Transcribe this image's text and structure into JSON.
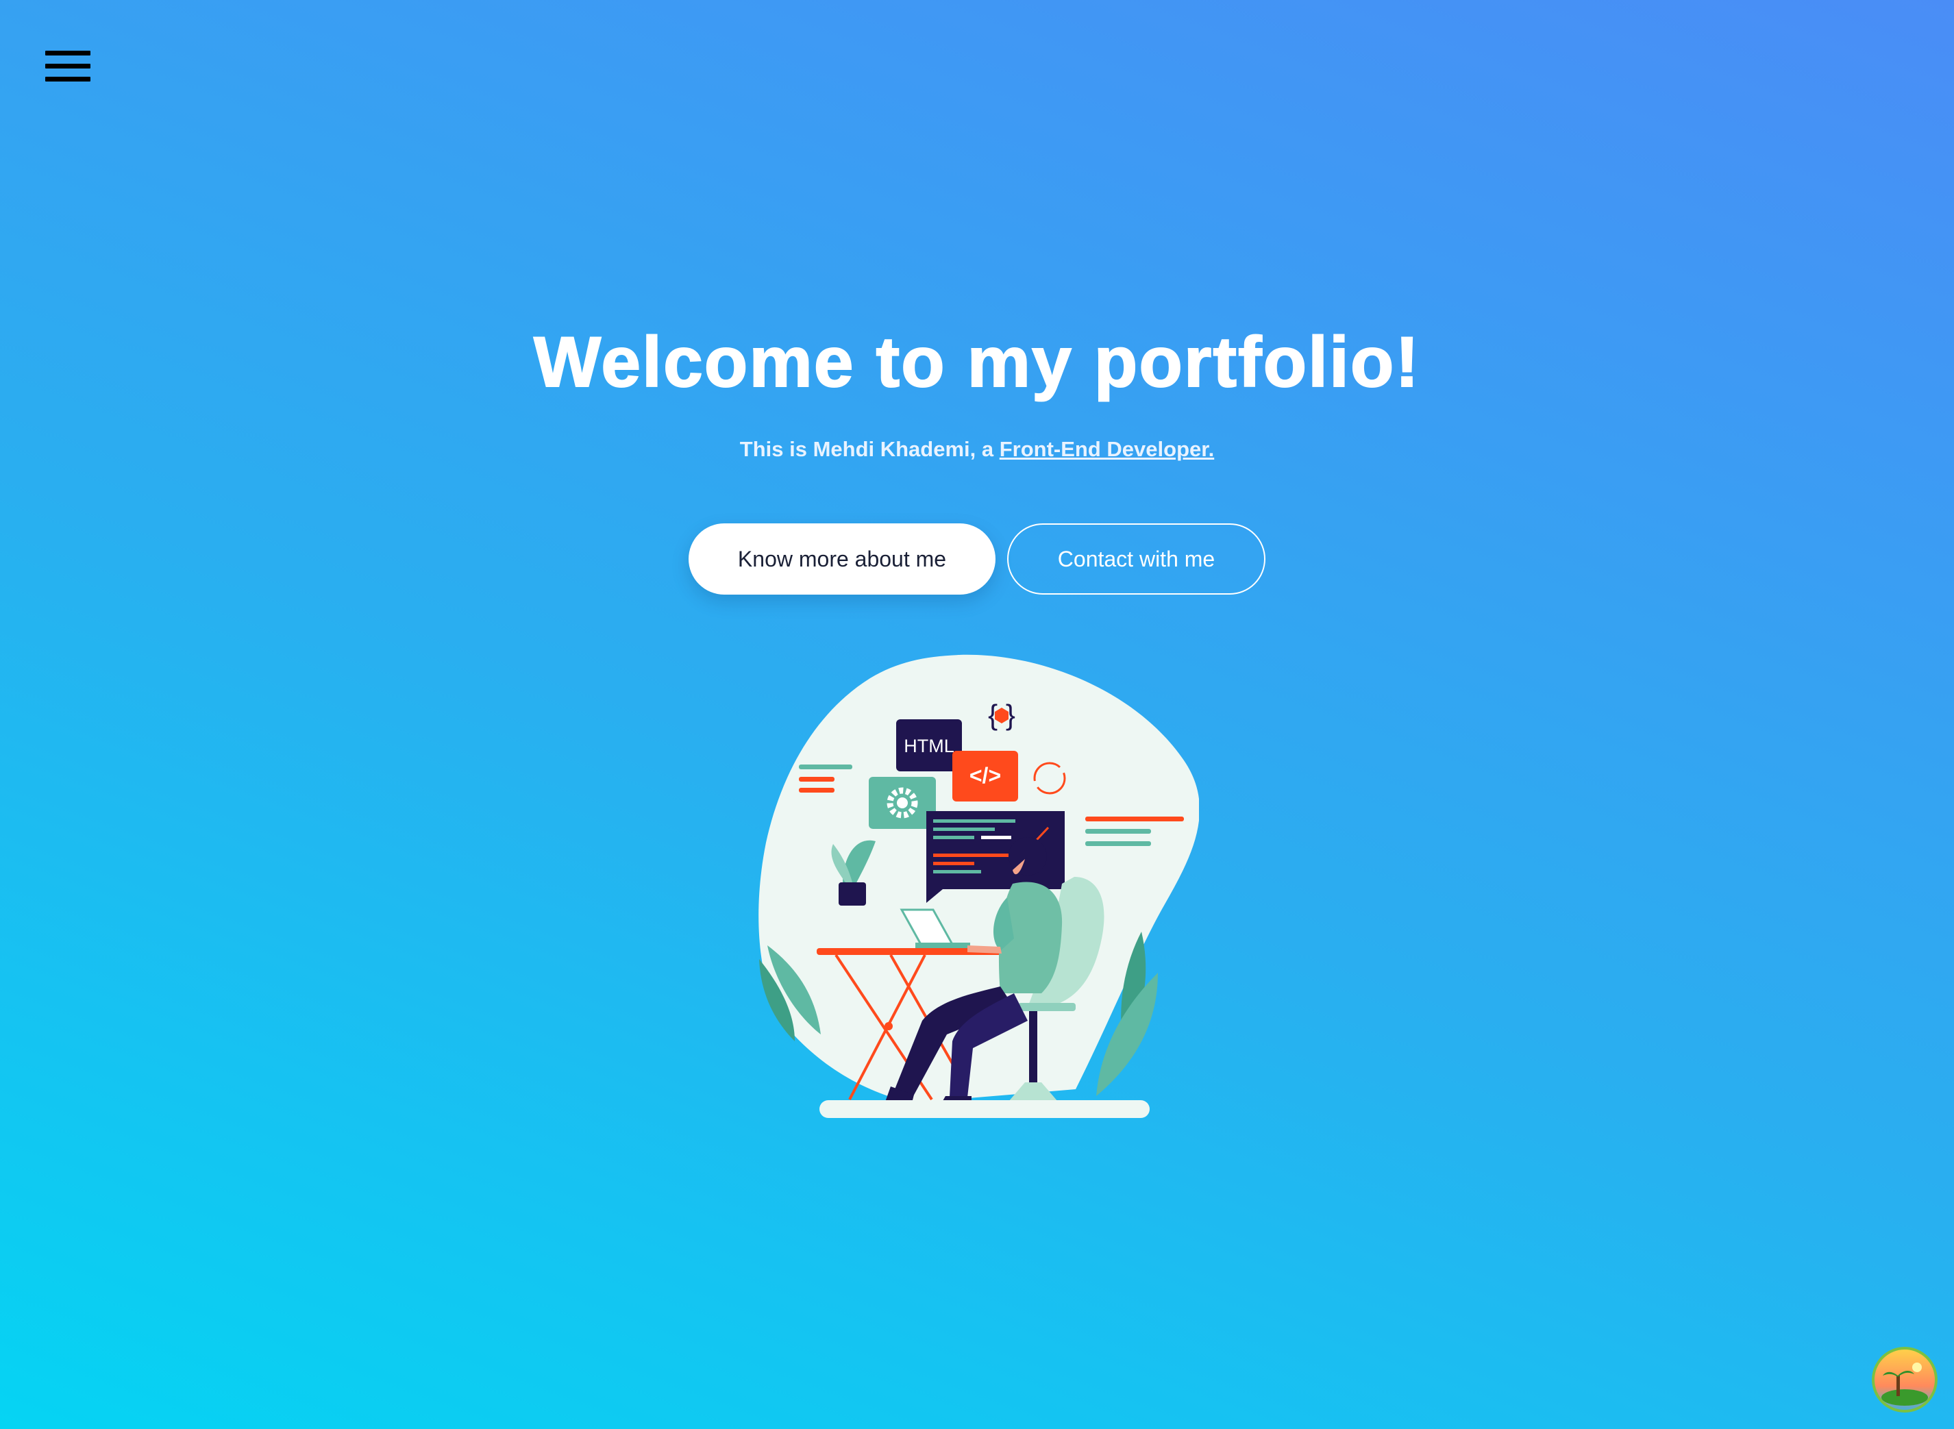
{
  "nav": {
    "menu_icon": "hamburger-menu-icon"
  },
  "hero": {
    "title": "Welcome to my portfolio!",
    "subtitle_prefix": "This is Mehdi Khademi, a ",
    "subtitle_link": "Front-End Developer."
  },
  "buttons": {
    "primary_label": "Know more about me",
    "secondary_label": "Contact with me"
  },
  "illustration": {
    "html_tag": "HTML",
    "code_tag": "</>",
    "braces": "{ }"
  },
  "corner_badge": {
    "icon": "palm-island-icon"
  },
  "colors": {
    "gradient_start": "#05d4f3",
    "gradient_end": "#4a8df6",
    "accent_orange": "#ff4a1c",
    "accent_teal": "#5fb9a3",
    "dark_navy": "#1f154f"
  }
}
